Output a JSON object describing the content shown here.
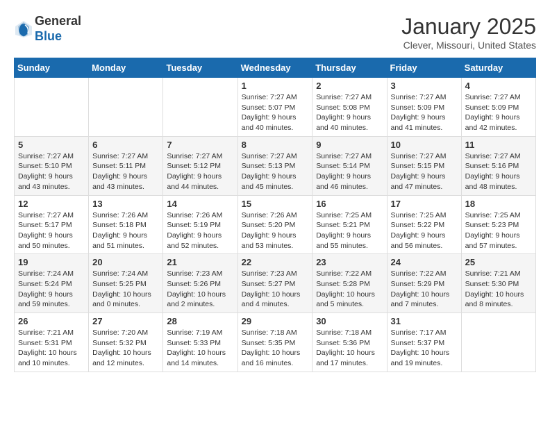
{
  "header": {
    "logo_line1": "General",
    "logo_line2": "Blue",
    "month": "January 2025",
    "location": "Clever, Missouri, United States"
  },
  "weekdays": [
    "Sunday",
    "Monday",
    "Tuesday",
    "Wednesday",
    "Thursday",
    "Friday",
    "Saturday"
  ],
  "weeks": [
    [
      {
        "day": "",
        "info": ""
      },
      {
        "day": "",
        "info": ""
      },
      {
        "day": "",
        "info": ""
      },
      {
        "day": "1",
        "info": "Sunrise: 7:27 AM\nSunset: 5:07 PM\nDaylight: 9 hours\nand 40 minutes."
      },
      {
        "day": "2",
        "info": "Sunrise: 7:27 AM\nSunset: 5:08 PM\nDaylight: 9 hours\nand 40 minutes."
      },
      {
        "day": "3",
        "info": "Sunrise: 7:27 AM\nSunset: 5:09 PM\nDaylight: 9 hours\nand 41 minutes."
      },
      {
        "day": "4",
        "info": "Sunrise: 7:27 AM\nSunset: 5:09 PM\nDaylight: 9 hours\nand 42 minutes."
      }
    ],
    [
      {
        "day": "5",
        "info": "Sunrise: 7:27 AM\nSunset: 5:10 PM\nDaylight: 9 hours\nand 43 minutes."
      },
      {
        "day": "6",
        "info": "Sunrise: 7:27 AM\nSunset: 5:11 PM\nDaylight: 9 hours\nand 43 minutes."
      },
      {
        "day": "7",
        "info": "Sunrise: 7:27 AM\nSunset: 5:12 PM\nDaylight: 9 hours\nand 44 minutes."
      },
      {
        "day": "8",
        "info": "Sunrise: 7:27 AM\nSunset: 5:13 PM\nDaylight: 9 hours\nand 45 minutes."
      },
      {
        "day": "9",
        "info": "Sunrise: 7:27 AM\nSunset: 5:14 PM\nDaylight: 9 hours\nand 46 minutes."
      },
      {
        "day": "10",
        "info": "Sunrise: 7:27 AM\nSunset: 5:15 PM\nDaylight: 9 hours\nand 47 minutes."
      },
      {
        "day": "11",
        "info": "Sunrise: 7:27 AM\nSunset: 5:16 PM\nDaylight: 9 hours\nand 48 minutes."
      }
    ],
    [
      {
        "day": "12",
        "info": "Sunrise: 7:27 AM\nSunset: 5:17 PM\nDaylight: 9 hours\nand 50 minutes."
      },
      {
        "day": "13",
        "info": "Sunrise: 7:26 AM\nSunset: 5:18 PM\nDaylight: 9 hours\nand 51 minutes."
      },
      {
        "day": "14",
        "info": "Sunrise: 7:26 AM\nSunset: 5:19 PM\nDaylight: 9 hours\nand 52 minutes."
      },
      {
        "day": "15",
        "info": "Sunrise: 7:26 AM\nSunset: 5:20 PM\nDaylight: 9 hours\nand 53 minutes."
      },
      {
        "day": "16",
        "info": "Sunrise: 7:25 AM\nSunset: 5:21 PM\nDaylight: 9 hours\nand 55 minutes."
      },
      {
        "day": "17",
        "info": "Sunrise: 7:25 AM\nSunset: 5:22 PM\nDaylight: 9 hours\nand 56 minutes."
      },
      {
        "day": "18",
        "info": "Sunrise: 7:25 AM\nSunset: 5:23 PM\nDaylight: 9 hours\nand 57 minutes."
      }
    ],
    [
      {
        "day": "19",
        "info": "Sunrise: 7:24 AM\nSunset: 5:24 PM\nDaylight: 9 hours\nand 59 minutes."
      },
      {
        "day": "20",
        "info": "Sunrise: 7:24 AM\nSunset: 5:25 PM\nDaylight: 10 hours\nand 0 minutes."
      },
      {
        "day": "21",
        "info": "Sunrise: 7:23 AM\nSunset: 5:26 PM\nDaylight: 10 hours\nand 2 minutes."
      },
      {
        "day": "22",
        "info": "Sunrise: 7:23 AM\nSunset: 5:27 PM\nDaylight: 10 hours\nand 4 minutes."
      },
      {
        "day": "23",
        "info": "Sunrise: 7:22 AM\nSunset: 5:28 PM\nDaylight: 10 hours\nand 5 minutes."
      },
      {
        "day": "24",
        "info": "Sunrise: 7:22 AM\nSunset: 5:29 PM\nDaylight: 10 hours\nand 7 minutes."
      },
      {
        "day": "25",
        "info": "Sunrise: 7:21 AM\nSunset: 5:30 PM\nDaylight: 10 hours\nand 8 minutes."
      }
    ],
    [
      {
        "day": "26",
        "info": "Sunrise: 7:21 AM\nSunset: 5:31 PM\nDaylight: 10 hours\nand 10 minutes."
      },
      {
        "day": "27",
        "info": "Sunrise: 7:20 AM\nSunset: 5:32 PM\nDaylight: 10 hours\nand 12 minutes."
      },
      {
        "day": "28",
        "info": "Sunrise: 7:19 AM\nSunset: 5:33 PM\nDaylight: 10 hours\nand 14 minutes."
      },
      {
        "day": "29",
        "info": "Sunrise: 7:18 AM\nSunset: 5:35 PM\nDaylight: 10 hours\nand 16 minutes."
      },
      {
        "day": "30",
        "info": "Sunrise: 7:18 AM\nSunset: 5:36 PM\nDaylight: 10 hours\nand 17 minutes."
      },
      {
        "day": "31",
        "info": "Sunrise: 7:17 AM\nSunset: 5:37 PM\nDaylight: 10 hours\nand 19 minutes."
      },
      {
        "day": "",
        "info": ""
      }
    ]
  ]
}
